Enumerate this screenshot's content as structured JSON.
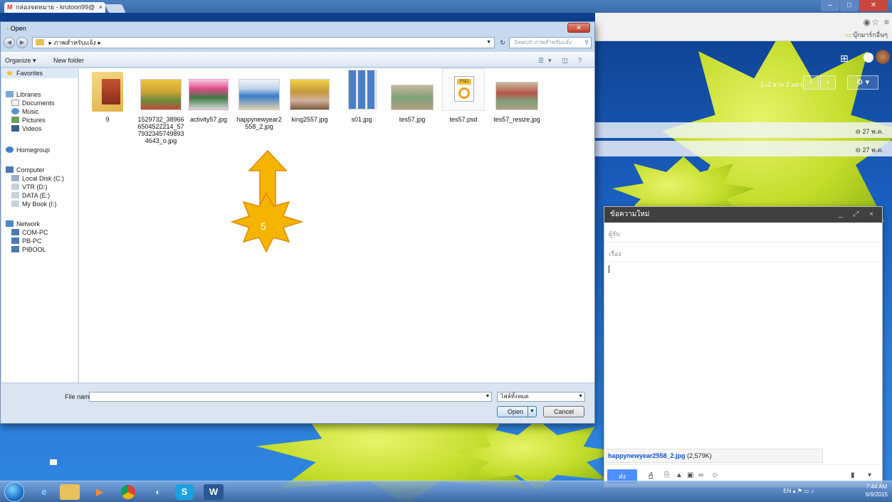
{
  "browser": {
    "tab_title": "กล่องจดหมาย - krutoon99@",
    "tab_close": "×",
    "bookmark_label": "บุ๊กมาร์กอื่นๆ"
  },
  "gmail": {
    "pager_text": "1–2 จาก 2 แถว",
    "prev": "‹",
    "next": "›",
    "gear": "⚙ ▾",
    "rows": [
      {
        "date": "27 พ.ค."
      },
      {
        "date": "27 พ.ค."
      }
    ]
  },
  "compose": {
    "title": "ข้อความใหม่",
    "controls": "_ ⤢ ×",
    "to_placeholder": "ผู้รับ",
    "subject_placeholder": "เรื่อง",
    "attachment_name": "happynewyear2558_2.jpg",
    "attachment_size": "(2,579K)",
    "attachment_close": "×",
    "send_label": "ส่ง"
  },
  "dialog": {
    "title": "Open",
    "close_label": "✕",
    "address_path": "▸ ภาพสำหรับแจ้ง ▸",
    "search_placeholder": "Search ภาพสำหรับแจ้ง",
    "organize_label": "Organize ▾",
    "new_folder_label": "New folder",
    "nav": {
      "favorites": "Favorites",
      "libraries": "Libraries",
      "documents": "Documents",
      "music": "Music",
      "pictures": "Pictures",
      "videos": "Videos",
      "homegroup": "Homegroup",
      "computer": "Computer",
      "local_disk": "Local Disk (C:)",
      "vtr": "VTR (D:)",
      "data": "DATA (E:)",
      "mybook": "My Book (I:)",
      "network": "Network",
      "com_pc": "COM-PC",
      "pb_pc": "PB-PC",
      "pibool": "PIBOOL"
    },
    "files": [
      {
        "name": "9"
      },
      {
        "name": "1529732_389666504522214_5779323457498934643_o.jpg"
      },
      {
        "name": "activity57.jpg"
      },
      {
        "name": "happynewyear2558_2.jpg"
      },
      {
        "name": "king2557.jpg"
      },
      {
        "name": "s01.jpg"
      },
      {
        "name": "tes57.jpg"
      },
      {
        "name": "tes57.psd"
      },
      {
        "name": "tes57_resize.jpg"
      }
    ],
    "file_name_label": "File name:",
    "file_name_value": "",
    "file_type": "ไฟล์ทั้งหมด",
    "open_label": "Open",
    "cancel_label": "Cancel"
  },
  "annotation": {
    "step_number": "5",
    "color": "#f5b400"
  },
  "taskbar": {
    "lang": "EN",
    "time": "7:44 AM",
    "date": "6/9/2015"
  }
}
